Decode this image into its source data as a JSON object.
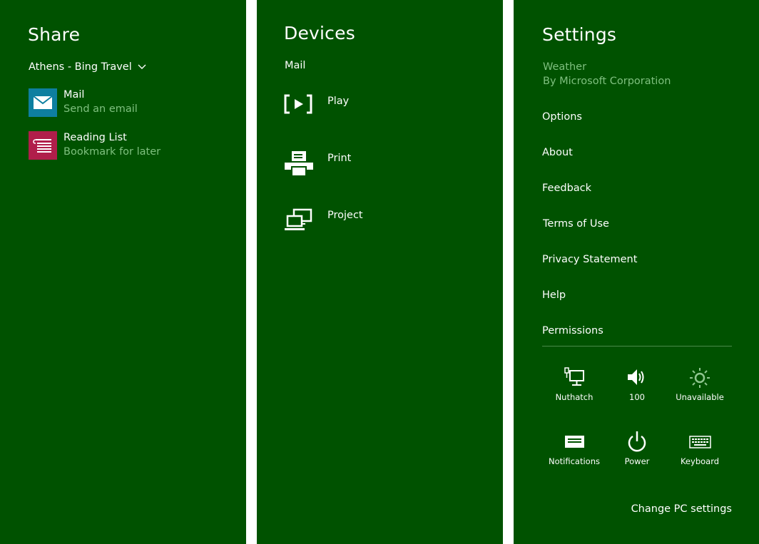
{
  "share": {
    "title": "Share",
    "source_app": "Athens - Bing Travel",
    "targets": [
      {
        "name": "Mail",
        "description": "Send an email",
        "icon": "mail-icon",
        "tile_color": "#0E7FA0"
      },
      {
        "name": "Reading List",
        "description": "Bookmark for later",
        "icon": "reading-list-icon",
        "tile_color": "#B01E4A"
      }
    ]
  },
  "devices": {
    "title": "Devices",
    "subtitle": "Mail",
    "items": [
      {
        "label": "Play",
        "icon": "play-icon"
      },
      {
        "label": "Print",
        "icon": "printer-icon"
      },
      {
        "label": "Project",
        "icon": "project-icon"
      }
    ]
  },
  "settings": {
    "title": "Settings",
    "app_name": "Weather",
    "publisher": "By Microsoft Corporation",
    "links": [
      "Options",
      "About",
      "Feedback",
      "Terms of Use",
      "Privacy Statement",
      "Help",
      "Permissions"
    ],
    "quick_settings": [
      {
        "label": "Nuthatch",
        "icon": "network-icon"
      },
      {
        "label": "100",
        "icon": "volume-icon"
      },
      {
        "label": "Unavailable",
        "icon": "brightness-icon"
      },
      {
        "label": "Notifications",
        "icon": "notifications-icon"
      },
      {
        "label": "Power",
        "icon": "power-icon"
      },
      {
        "label": "Keyboard",
        "icon": "keyboard-icon"
      }
    ],
    "change_pc_settings": "Change PC settings"
  },
  "colors": {
    "pane_background": "#005200",
    "separator": "#FFFFFF",
    "secondary_text": "#7FC07F",
    "text": "#FFFFFF"
  }
}
